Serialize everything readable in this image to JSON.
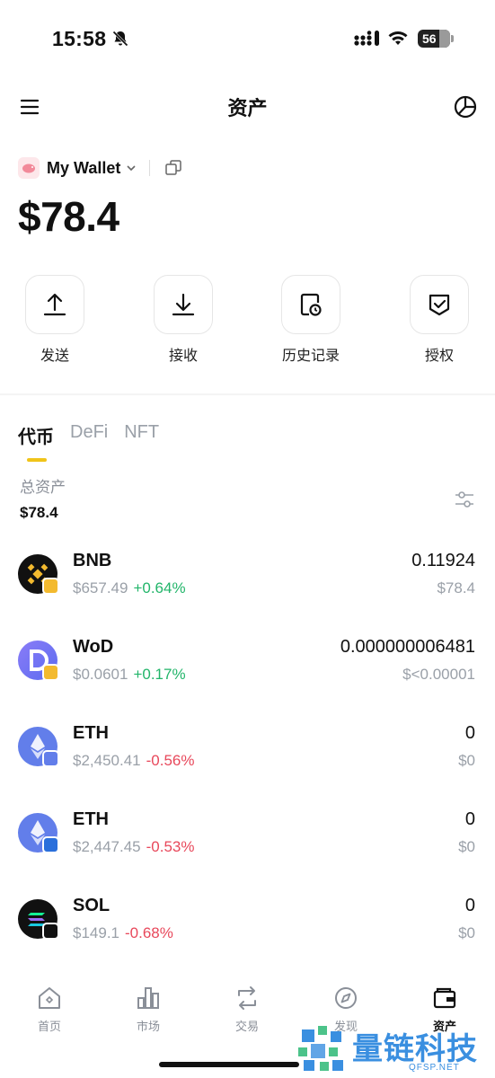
{
  "status_bar": {
    "time": "15:58",
    "battery": "56"
  },
  "header": {
    "title": "资产"
  },
  "wallet": {
    "name": "My Wallet",
    "balance": "$78.4"
  },
  "actions": [
    {
      "label": "发送",
      "icon": "upload-icon"
    },
    {
      "label": "接收",
      "icon": "download-icon"
    },
    {
      "label": "历史记录",
      "icon": "history-icon"
    },
    {
      "label": "授权",
      "icon": "shield-check-icon"
    }
  ],
  "tabs": [
    {
      "label": "代币",
      "active": true
    },
    {
      "label": "DeFi",
      "active": false
    },
    {
      "label": "NFT",
      "active": false
    }
  ],
  "summary": {
    "label": "总资产",
    "value": "$78.4"
  },
  "tokens": [
    {
      "symbol": "BNB",
      "price": "$657.49",
      "change": "+0.64%",
      "amount": "0.11924",
      "value": "$78.4",
      "color": "#111111",
      "badge_color": "#f3ba2f"
    },
    {
      "symbol": "WoD",
      "price": "$0.0601",
      "change": "+0.17%",
      "amount": "0.000000006481",
      "value": "$<0.00001",
      "color": "#6e6ef5",
      "badge_color": "#f3ba2f"
    },
    {
      "symbol": "ETH",
      "price": "$2,450.41",
      "change": "-0.56%",
      "amount": "0",
      "value": "$0",
      "color": "#627eea",
      "badge_color": "#627eea"
    },
    {
      "symbol": "ETH",
      "price": "$2,447.45",
      "change": "-0.53%",
      "amount": "0",
      "value": "$0",
      "color": "#627eea",
      "badge_color": "#2a6fdb"
    },
    {
      "symbol": "SOL",
      "price": "$149.1",
      "change": "-0.68%",
      "amount": "0",
      "value": "$0",
      "color": "#111111",
      "badge_color": "#111111"
    }
  ],
  "bottom_nav": [
    {
      "label": "首页",
      "icon": "home-icon",
      "active": false
    },
    {
      "label": "市场",
      "icon": "market-chart-icon",
      "active": false
    },
    {
      "label": "交易",
      "icon": "swap-icon",
      "active": false
    },
    {
      "label": "发现",
      "icon": "compass-icon",
      "active": false
    },
    {
      "label": "资产",
      "icon": "wallet-icon",
      "active": true
    }
  ],
  "watermark": {
    "text": "量链科技",
    "sub": "QFSP.NET"
  },
  "colors": {
    "up": "#22b56a",
    "down": "#e8485b",
    "accent": "#f0c419"
  }
}
